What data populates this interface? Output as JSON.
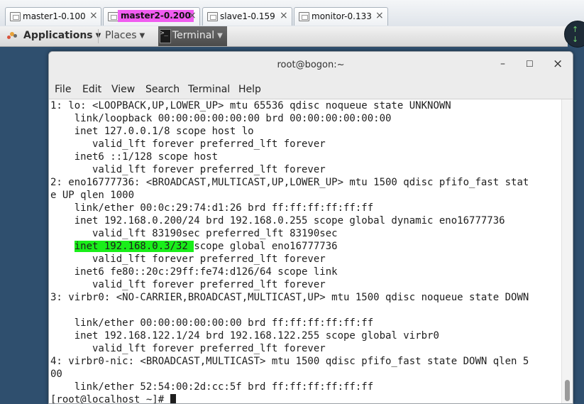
{
  "vm_tabs": [
    {
      "label": "master1-0.100",
      "active": false
    },
    {
      "label": "master2-0.200",
      "active": true
    },
    {
      "label": "slave1-0.159",
      "active": false
    },
    {
      "label": "monitor-0.133",
      "active": false
    }
  ],
  "tab_close_glyph": "×",
  "gnome_bar": {
    "applications": "Applications",
    "places": "Places",
    "terminal": "Terminal"
  },
  "window": {
    "title": "root@bogon:~",
    "minimize": "–",
    "maximize": "☐",
    "close": "×"
  },
  "menu": [
    "File",
    "Edit",
    "View",
    "Search",
    "Terminal",
    "Help"
  ],
  "terminal": {
    "lines": [
      "1: lo: <LOOPBACK,UP,LOWER_UP> mtu 65536 qdisc noqueue state UNKNOWN",
      "    link/loopback 00:00:00:00:00:00 brd 00:00:00:00:00:00",
      "    inet 127.0.0.1/8 scope host lo",
      "       valid_lft forever preferred_lft forever",
      "    inet6 ::1/128 scope host",
      "       valid_lft forever preferred_lft forever",
      "2: eno16777736: <BROADCAST,MULTICAST,UP,LOWER_UP> mtu 1500 qdisc pfifo_fast stat",
      "e UP qlen 1000",
      "    link/ether 00:0c:29:74:d1:26 brd ff:ff:ff:ff:ff:ff",
      "    inet 192.168.0.200/24 brd 192.168.0.255 scope global dynamic eno16777736",
      "       valid_lft 83190sec preferred_lft 83190sec",
      "",
      "       valid_lft forever preferred_lft forever",
      "    inet6 fe80::20c:29ff:fe74:d126/64 scope link",
      "       valid_lft forever preferred_lft forever",
      "3: virbr0: <NO-CARRIER,BROADCAST,MULTICAST,UP> mtu 1500 qdisc noqueue state DOWN",
      "",
      "    link/ether 00:00:00:00:00:00 brd ff:ff:ff:ff:ff:ff",
      "    inet 192.168.122.1/24 brd 192.168.122.255 scope global virbr0",
      "       valid_lft forever preferred_lft forever",
      "4: virbr0-nic: <BROADCAST,MULTICAST> mtu 1500 qdisc pfifo_fast state DOWN qlen 5",
      "00",
      "    link/ether 52:54:00:2d:cc:5f brd ff:ff:ff:ff:ff:ff"
    ],
    "vip_line": {
      "indent": "    ",
      "highlighted": "inet 192.168.0.3/32 ",
      "rest": "scope global eno16777736"
    },
    "prompt": "[root@localhost ~]# "
  },
  "colors": {
    "active_tab": "#f05cf0",
    "highlight": "#19ee19"
  }
}
